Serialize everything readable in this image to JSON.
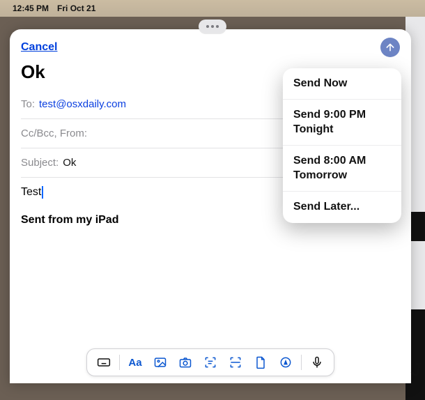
{
  "status": {
    "time": "12:45 PM",
    "date": "Fri Oct 21"
  },
  "compose": {
    "cancel": "Cancel",
    "subject_display": "Ok",
    "to_label": "To:",
    "to_value": "test@osxdaily.com",
    "ccbcc_label": "Cc/Bcc, From:",
    "subject_label": "Subject:",
    "subject_value": "Ok",
    "body": "Test",
    "signature": "Sent from my iPad"
  },
  "send_menu": {
    "items": [
      "Send Now",
      "Send 9:00 PM Tonight",
      "Send 8:00 AM Tomorrow",
      "Send Later..."
    ]
  },
  "toolbar": {
    "format_label": "Aa"
  }
}
